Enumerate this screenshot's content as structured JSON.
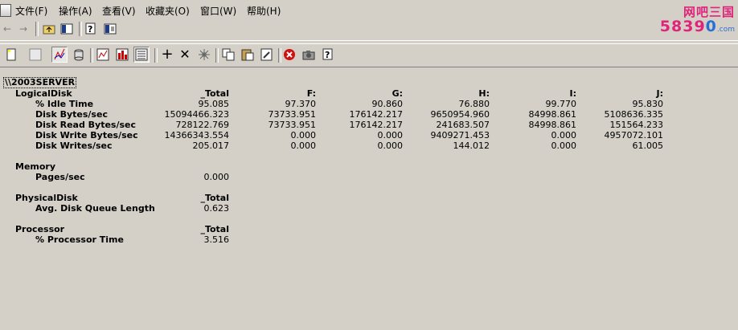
{
  "menubar": {
    "items": [
      "文件(F)",
      "操作(A)",
      "查看(V)",
      "收藏夹(O)",
      "窗口(W)",
      "帮助(H)"
    ]
  },
  "watermark": {
    "line1": "网吧三国",
    "line2a": "5839",
    "line2b": "0",
    "line2c": ".com"
  },
  "navbar": {
    "icons": [
      "back-arrow-icon",
      "forward-arrow-icon",
      "up-folder-icon",
      "show-tree-icon",
      "help-icon",
      "console-icon"
    ]
  },
  "toolbar": {
    "icons": [
      "new-counter-set-icon",
      "clear-display-icon",
      "view-graph-icon",
      "view-histogram-icon",
      "view-report-icon",
      "view-current-activity-icon",
      "view-log-data-icon",
      "add-counter-icon",
      "delete-counter-icon",
      "highlight-icon",
      "copy-properties-icon",
      "paste-counter-list-icon",
      "properties-icon",
      "freeze-display-icon",
      "update-data-icon",
      "help-icon"
    ]
  },
  "report": {
    "server": "\\\\2003SERVER",
    "groups": [
      {
        "object": "LogicalDisk",
        "instances": [
          "_Total",
          "F:",
          "G:",
          "H:",
          "I:",
          "J:"
        ],
        "counters": [
          {
            "name": "% Idle Time",
            "values": [
              "95.085",
              "97.370",
              "90.860",
              "76.880",
              "99.770",
              "95.830"
            ]
          },
          {
            "name": "Disk Bytes/sec",
            "values": [
              "15094466.323",
              "73733.951",
              "176142.217",
              "9650954.960",
              "84998.861",
              "5108636.335"
            ]
          },
          {
            "name": "Disk Read Bytes/sec",
            "values": [
              "728122.769",
              "73733.951",
              "176142.217",
              "241683.507",
              "84998.861",
              "151564.233"
            ]
          },
          {
            "name": "Disk Write Bytes/sec",
            "values": [
              "14366343.554",
              "0.000",
              "0.000",
              "9409271.453",
              "0.000",
              "4957072.101"
            ]
          },
          {
            "name": "Disk Writes/sec",
            "values": [
              "205.017",
              "0.000",
              "0.000",
              "144.012",
              "0.000",
              "61.005"
            ]
          }
        ]
      },
      {
        "object": "Memory",
        "instances": [
          ""
        ],
        "counters": [
          {
            "name": "Pages/sec",
            "values": [
              "0.000"
            ]
          }
        ]
      },
      {
        "object": "PhysicalDisk",
        "instances": [
          "_Total"
        ],
        "counters": [
          {
            "name": "Avg. Disk Queue Length",
            "values": [
              "0.623"
            ]
          }
        ]
      },
      {
        "object": "Processor",
        "instances": [
          "_Total"
        ],
        "counters": [
          {
            "name": "% Processor Time",
            "values": [
              "3.516"
            ]
          }
        ]
      }
    ]
  }
}
